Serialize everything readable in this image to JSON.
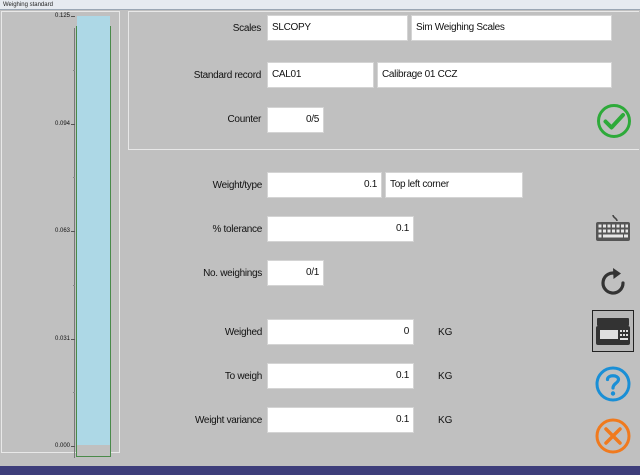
{
  "window": {
    "title": "Weighing standard"
  },
  "gauge": {
    "ticks": [
      "0.125",
      "0.094",
      "0.063",
      "0.031",
      "0.000"
    ],
    "fill_fraction": 1.0
  },
  "form": {
    "scales": {
      "label": "Scales",
      "code": "SLCOPY",
      "name": "Sim Weighing Scales"
    },
    "standard_record": {
      "label": "Standard record",
      "code": "CAL01",
      "name": "Calibrage 01 CCZ"
    },
    "counter": {
      "label": "Counter",
      "value": "0/5"
    },
    "weight_type": {
      "label": "Weight/type",
      "value": "0.1",
      "description": "Top left corner"
    },
    "tolerance": {
      "label": "% tolerance",
      "value": "0.1"
    },
    "num_weighings": {
      "label": "No. weighings",
      "value": "0/1"
    },
    "weighed": {
      "label": "Weighed",
      "value": "0",
      "unit": "KG"
    },
    "to_weigh": {
      "label": "To weigh",
      "value": "0.1",
      "unit": "KG"
    },
    "variance": {
      "label": "Weight variance",
      "value": "0.1",
      "unit": "KG"
    }
  },
  "colors": {
    "background": "#c0c0c0",
    "confirm_green": "#2eaa3a",
    "help_blue": "#1a8fd6",
    "cancel_orange": "#f07a1e",
    "gauge_fill": "#add8e6",
    "bottom_bar": "#3d3d7a"
  },
  "icons": {
    "confirm": "checkmark-circle-icon",
    "keyboard": "keyboard-icon",
    "refresh": "refresh-icon",
    "scale": "scale-device-icon",
    "help": "question-circle-icon",
    "cancel": "close-circle-icon"
  }
}
